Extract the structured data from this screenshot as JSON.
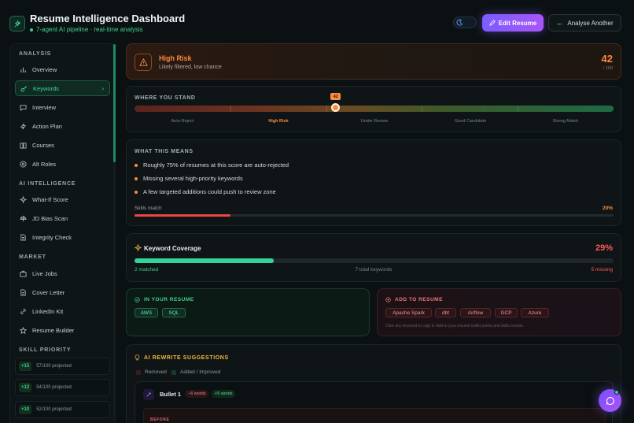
{
  "header": {
    "title": "Resume Intelligence Dashboard",
    "subtitle": "7-agent AI pipeline · real-time analysis",
    "edit_label": "Edit Resume",
    "analyse_label": "Analyse Another"
  },
  "sidebar": {
    "analysis_label": "ANALYSIS",
    "analysis_items": [
      {
        "label": "Overview",
        "icon": "bar-chart-icon"
      },
      {
        "label": "Keywords",
        "icon": "key-icon",
        "active": true
      },
      {
        "label": "Interview",
        "icon": "chat-icon"
      },
      {
        "label": "Action Plan",
        "icon": "lightning-icon"
      },
      {
        "label": "Courses",
        "icon": "book-icon"
      },
      {
        "label": "Alt Roles",
        "icon": "target-icon"
      }
    ],
    "ai_label": "AI INTELLIGENCE",
    "ai_items": [
      {
        "label": "What-If Score",
        "icon": "sparkle-icon"
      },
      {
        "label": "JD Bias Scan",
        "icon": "scale-icon"
      },
      {
        "label": "Integrity Check",
        "icon": "document-icon"
      }
    ],
    "market_label": "MARKET",
    "market_items": [
      {
        "label": "Live Jobs",
        "icon": "briefcase-icon"
      },
      {
        "label": "Cover Letter",
        "icon": "document-icon"
      },
      {
        "label": "LinkedIn Kit",
        "icon": "link-icon"
      },
      {
        "label": "Resume Builder",
        "icon": "star-icon"
      }
    ],
    "skill_label": "SKILL PRIORITY",
    "skills": [
      {
        "badge": "+15",
        "text": "57/100 projected"
      },
      {
        "badge": "+12",
        "text": "54/100 projected"
      },
      {
        "badge": "+10",
        "text": "52/100 projected"
      }
    ]
  },
  "risk": {
    "title": "High Risk",
    "subtitle": "Likely filtered, low chance",
    "score": "42",
    "max": "/ 100"
  },
  "stand": {
    "title": "WHERE YOU STAND",
    "marker_label": "42",
    "score_fraction": 0.42,
    "zones": [
      "Auto-Reject",
      "High Risk",
      "Under Review",
      "Good Candidate",
      "Strong Match"
    ]
  },
  "means": {
    "title": "WHAT THIS MEANS",
    "bullets": [
      "Roughly 75% of resumes at this score are auto-rejected",
      "Missing several high-priority keywords",
      "A few targeted additions could push to review zone"
    ],
    "skills_label": "Skills match",
    "skills_pct": "20%",
    "skills_fraction": 0.2
  },
  "keywords": {
    "title": "Keyword Coverage",
    "pct": "29%",
    "fraction": 0.29,
    "matched": "2 matched",
    "total": "7 total keywords",
    "missing": "5 missing"
  },
  "in_resume": {
    "title": "IN YOUR RESUME",
    "chips": [
      "AWS",
      "SQL"
    ]
  },
  "add_resume": {
    "title": "ADD TO RESUME",
    "chips": [
      "Apache Spark",
      "dbt",
      "Airflow",
      "GCP",
      "Azure"
    ],
    "hint": "Click any keyword to copy it. Add to your resume bullet points and skills section."
  },
  "ai": {
    "title": "AI REWRITE SUGGESTIONS",
    "legend_removed": "Removed",
    "legend_added": "Added / Improved",
    "bullet_title": "Bullet 1",
    "pill_removed": "−6 words",
    "pill_added": "+5 words",
    "before_label": "BEFORE"
  },
  "colors": {
    "accent_green": "#3fcf8e",
    "accent_orange": "#ff8a3d",
    "accent_purple": "#8b5cf6",
    "danger": "#ff5a5a"
  }
}
